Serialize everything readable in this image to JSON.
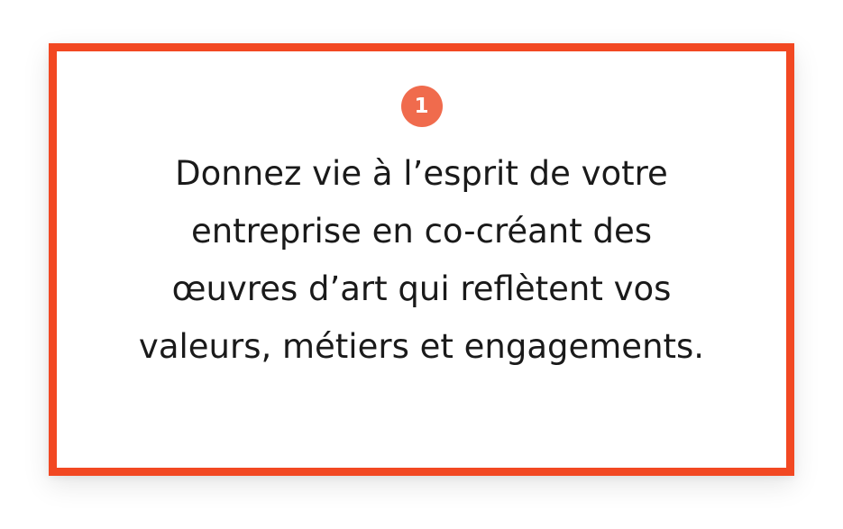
{
  "card": {
    "step_number": "1",
    "text": "Donnez vie à l’esprit de votre entreprise en co-créant des œuvres d’art qui reflètent vos valeurs, métiers et engagements."
  },
  "colors": {
    "border": "#f24822",
    "badge": "#f06b4d",
    "text": "#1a1a1a",
    "background": "#ffffff"
  }
}
